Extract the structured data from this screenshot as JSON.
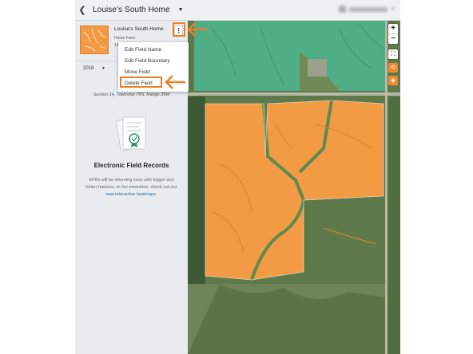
{
  "header": {
    "title": "Louise's South Home",
    "back_icon": "chevron-left-icon"
  },
  "field": {
    "name": "Louise's South Home",
    "farm": "Home Farm",
    "acres": "14..."
  },
  "year": {
    "selected": "2018"
  },
  "location": {
    "line1": "Co...",
    "line2": "Section 14, Township 75N, Range 35W"
  },
  "menu": {
    "items": [
      {
        "label": "Edit Field Name"
      },
      {
        "label": "Edit Field Boundary"
      },
      {
        "label": "Move Field"
      },
      {
        "label": "Delete Field"
      }
    ]
  },
  "efr": {
    "title": "Electronic Field Records",
    "desc_before": "EFRs will be returning soon with bigger and better features. In the meantime, check out our ",
    "link": "new interactive heatmaps",
    "desc_after": "."
  },
  "map": {
    "zoom_in": "+",
    "zoom_out": "−",
    "extent_icon": "⛶",
    "icon_1": "⟲",
    "icon_2": "◈"
  },
  "colors": {
    "field_orange": "#f39a45",
    "callout_orange": "#f07f24",
    "map_green": "#4fae86",
    "link_blue": "#1f6fb2"
  }
}
